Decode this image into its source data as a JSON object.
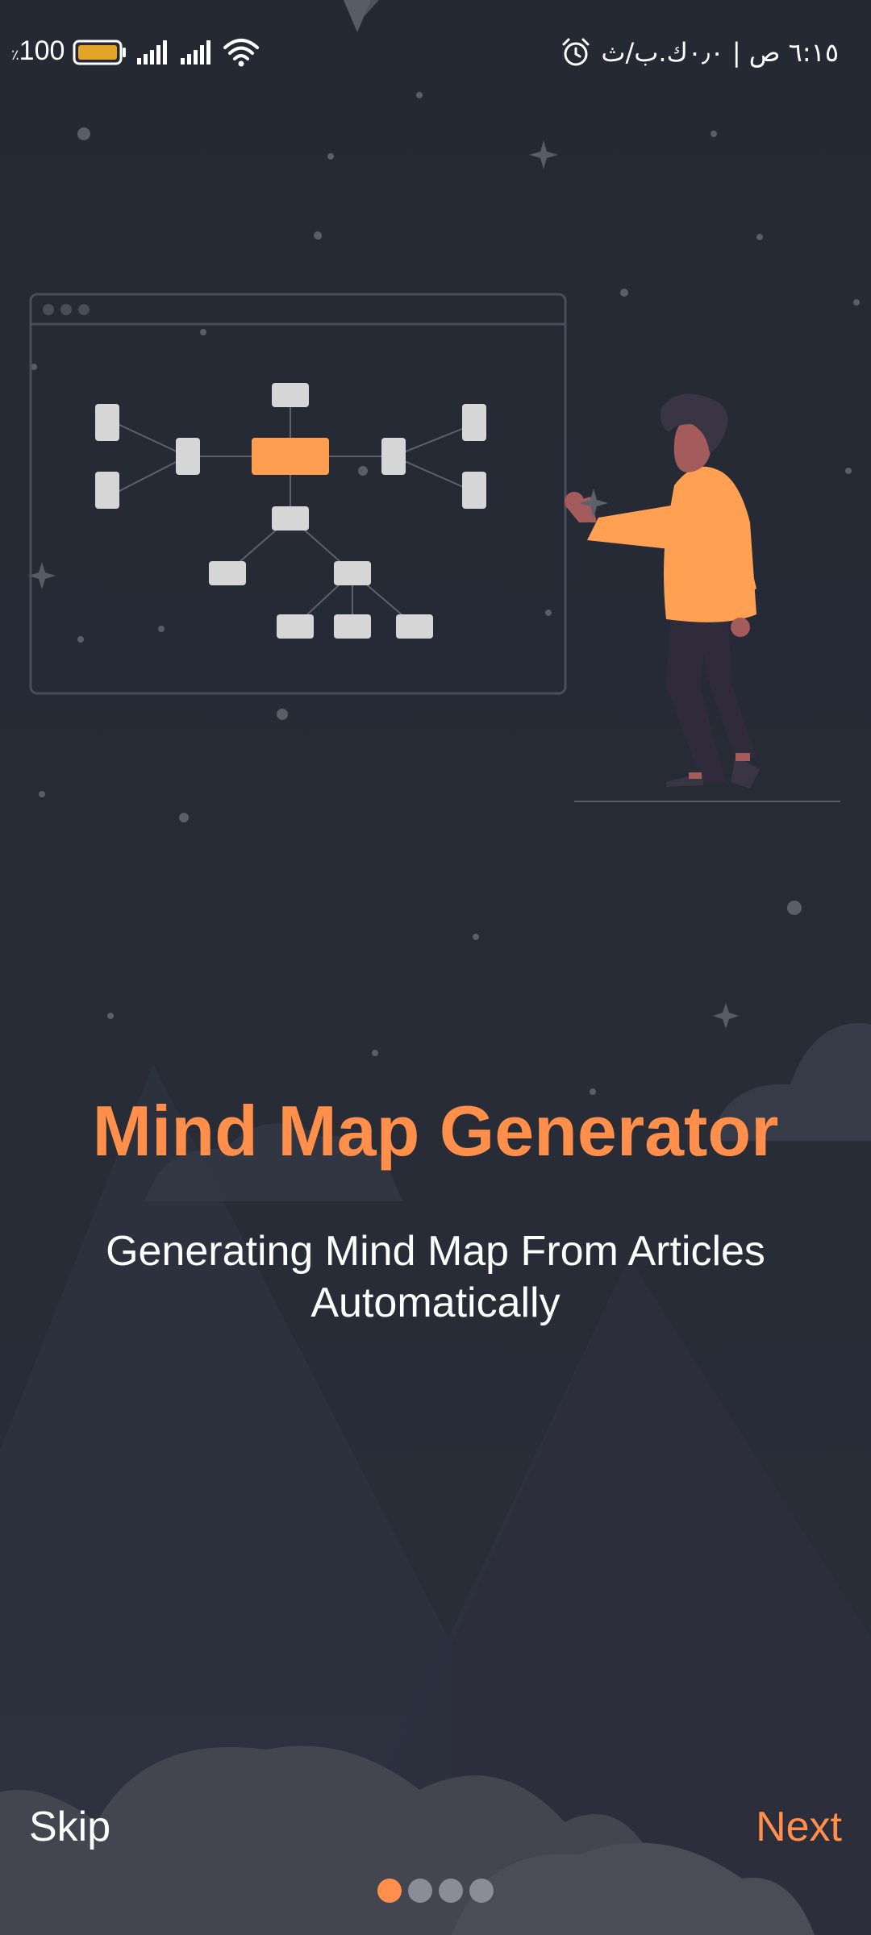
{
  "status_bar": {
    "battery_level": "100",
    "battery_unit": "٪",
    "time_text": "٦:١٥ ص | ٠٫٠ك.ب/ث",
    "icons": [
      "battery-icon",
      "signal-icon",
      "signal-icon",
      "wifi-icon",
      "alarm-icon"
    ]
  },
  "onboarding": {
    "title": "Mind Map Generator",
    "subtitle": "Generating Mind Map From Articles Automatically",
    "skip_label": "Skip",
    "next_label": "Next",
    "page_count": 4,
    "current_page": 1
  },
  "colors": {
    "background": "#262a34",
    "accent": "#ff8f4a",
    "node": "#d6d6d6",
    "text": "#ffffff",
    "dot_inactive": "#8a8d95"
  }
}
